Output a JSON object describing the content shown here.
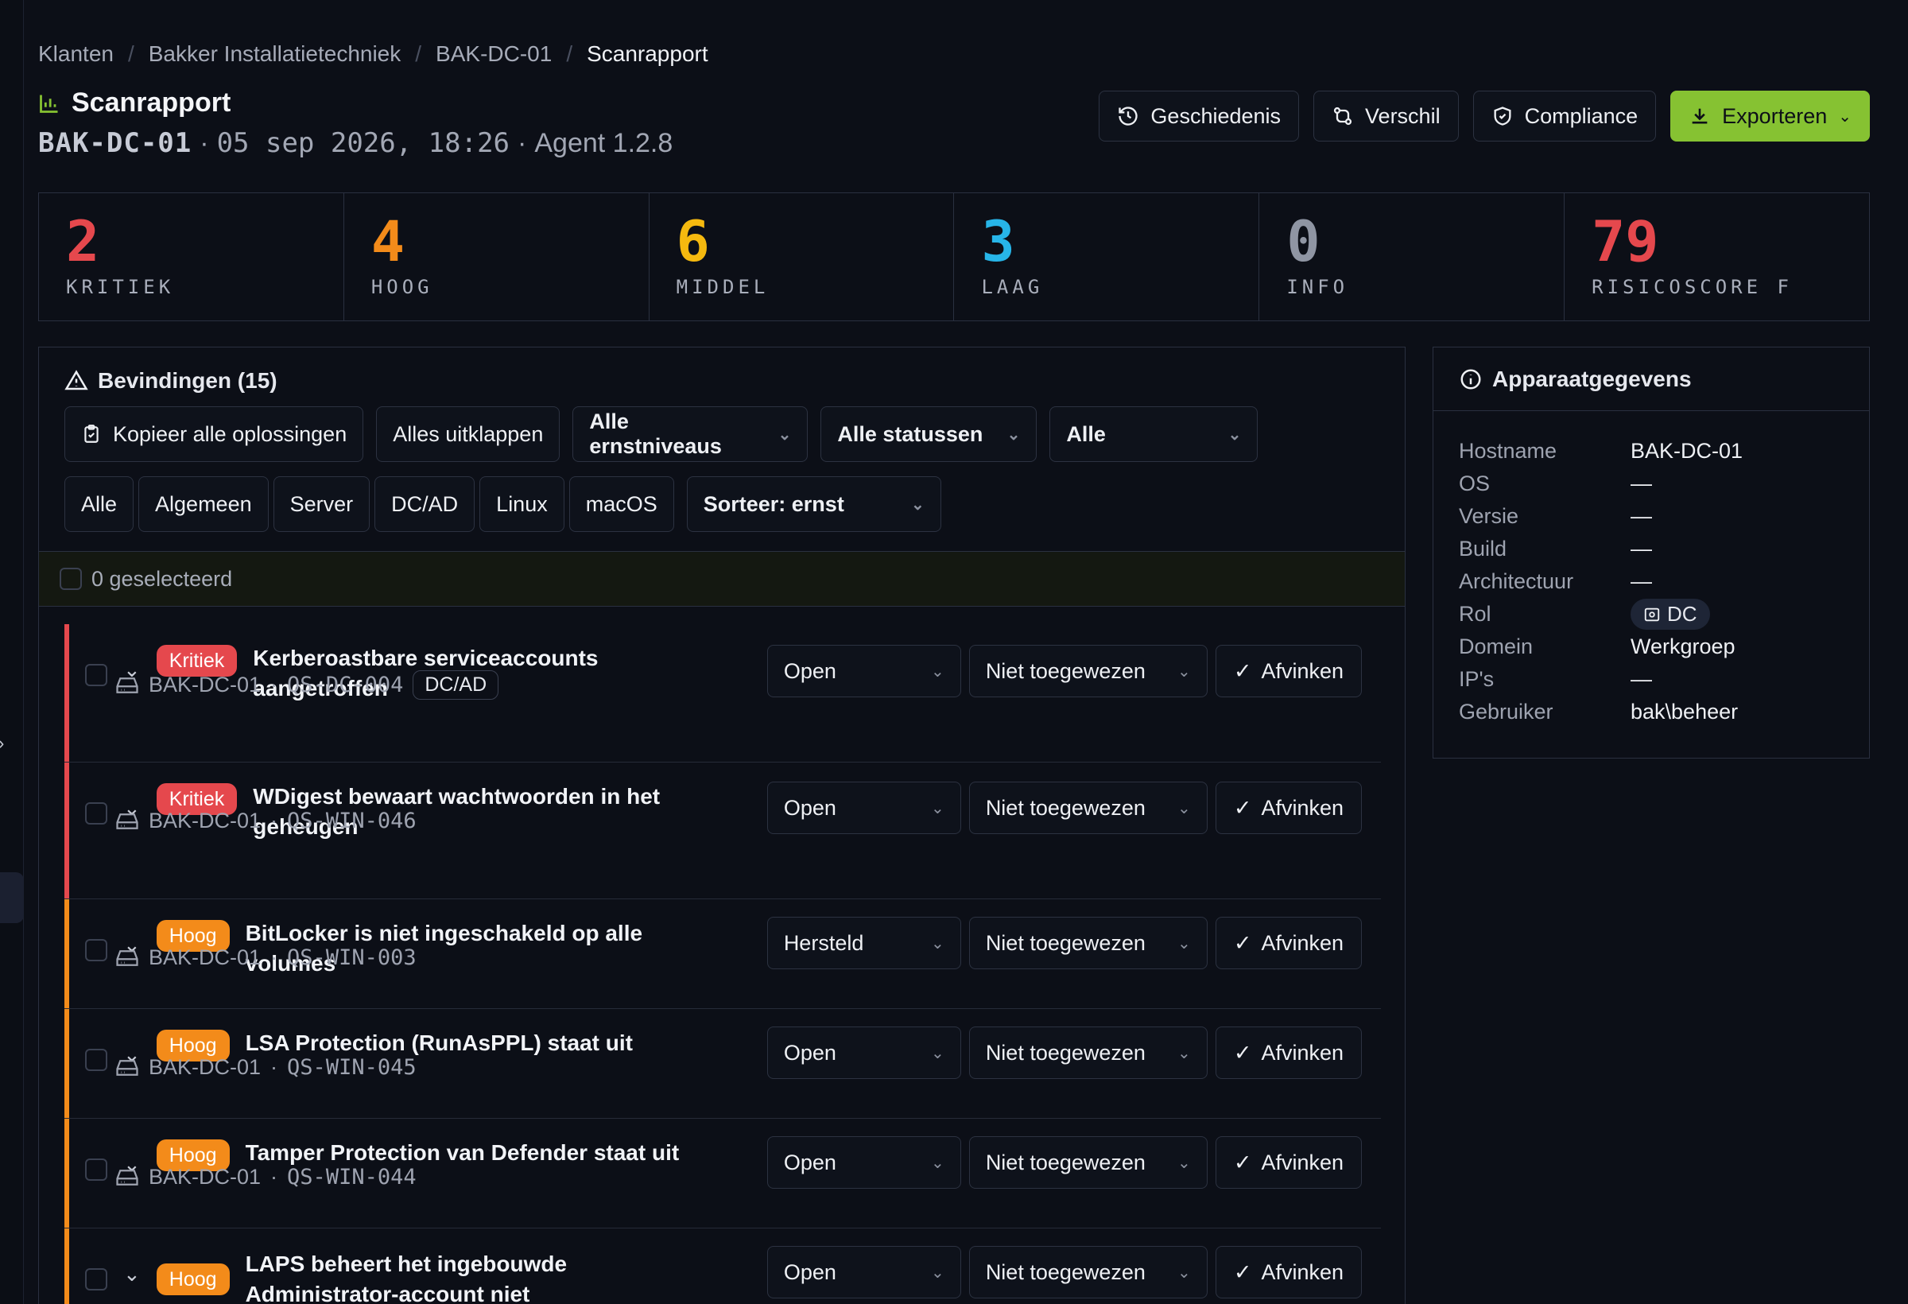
{
  "breadcrumb": [
    "Klanten",
    "Bakker Installatietechniek",
    "BAK-DC-01",
    "Scanrapport"
  ],
  "header": {
    "title": "Scanrapport",
    "host": "BAK-DC-01",
    "scan_date": "05 sep 2026, 18:26",
    "agent": "Agent 1.2.8",
    "sep": "·"
  },
  "actions": {
    "history": "Geschiedenis",
    "diff": "Verschil",
    "compliance": "Compliance",
    "export": "Exporteren"
  },
  "stats": [
    {
      "value": "2",
      "label": "KRITIEK",
      "color": "#e5484d"
    },
    {
      "value": "4",
      "label": "HOOG",
      "color": "#f38b1a"
    },
    {
      "value": "6",
      "label": "MIDDEL",
      "color": "#f5b90f"
    },
    {
      "value": "3",
      "label": "LAAG",
      "color": "#27b5e8"
    },
    {
      "value": "0",
      "label": "INFO",
      "color": "#8f95a3"
    },
    {
      "value": "79",
      "label": "RISICOSCORE F",
      "color": "#e5484d"
    }
  ],
  "findings": {
    "heading": "Bevindingen (15)",
    "copy_all": "Kopieer alle oplossingen",
    "expand_all": "Alles uitklappen",
    "severity_filter": "Alle ernstniveaus",
    "status_filter": "Alle statussen",
    "other_filter": "Alle",
    "categories": [
      "Alle",
      "Algemeen",
      "Server",
      "DC/AD",
      "Linux",
      "macOS"
    ],
    "sort": "Sorteer: ernst",
    "selected": "0 geselecteerd",
    "check_label": "Afvinken",
    "items": [
      {
        "severity": "Kritiek",
        "sev": "kritiek",
        "title": "Kerberoastbare serviceaccounts aangetroffen",
        "host": "BAK-DC-01",
        "id": "QS-DC-004",
        "tag": "DC/AD",
        "status": "Open",
        "assignee": "Niet toegewezen"
      },
      {
        "severity": "Kritiek",
        "sev": "kritiek",
        "title": "WDigest bewaart wachtwoorden in het geheugen",
        "host": "BAK-DC-01",
        "id": "QS-WIN-046",
        "tag": "",
        "status": "Open",
        "assignee": "Niet toegewezen"
      },
      {
        "severity": "Hoog",
        "sev": "hoog",
        "title": "BitLocker is niet ingeschakeld op alle volumes",
        "host": "BAK-DC-01",
        "id": "QS-WIN-003",
        "tag": "",
        "status": "Hersteld",
        "assignee": "Niet toegewezen"
      },
      {
        "severity": "Hoog",
        "sev": "hoog",
        "title": "LSA Protection (RunAsPPL) staat uit",
        "host": "BAK-DC-01",
        "id": "QS-WIN-045",
        "tag": "",
        "status": "Open",
        "assignee": "Niet toegewezen"
      },
      {
        "severity": "Hoog",
        "sev": "hoog",
        "title": "Tamper Protection van Defender staat uit",
        "host": "BAK-DC-01",
        "id": "QS-WIN-044",
        "tag": "",
        "status": "Open",
        "assignee": "Niet toegewezen"
      },
      {
        "severity": "Hoog",
        "sev": "hoog",
        "title": "LAPS beheert het ingebouwde Administrator-account niet",
        "host": "",
        "id": "",
        "tag": "",
        "status": "Open",
        "assignee": "Niet toegewezen"
      }
    ]
  },
  "device": {
    "heading": "Apparaatgegevens",
    "rows": [
      {
        "k": "Hostname",
        "v": "BAK-DC-01"
      },
      {
        "k": "OS",
        "v": "—"
      },
      {
        "k": "Versie",
        "v": "—"
      },
      {
        "k": "Build",
        "v": "—"
      },
      {
        "k": "Architectuur",
        "v": "—"
      },
      {
        "k": "Rol",
        "v": "DC",
        "pill": true
      },
      {
        "k": "Domein",
        "v": "Werkgroep"
      },
      {
        "k": "IP's",
        "v": "—"
      },
      {
        "k": "Gebruiker",
        "v": "bak\\beheer"
      }
    ]
  },
  "colors": {
    "accent": "#86c232",
    "kritiek": "#e5484d",
    "hoog": "#f38b1a"
  }
}
